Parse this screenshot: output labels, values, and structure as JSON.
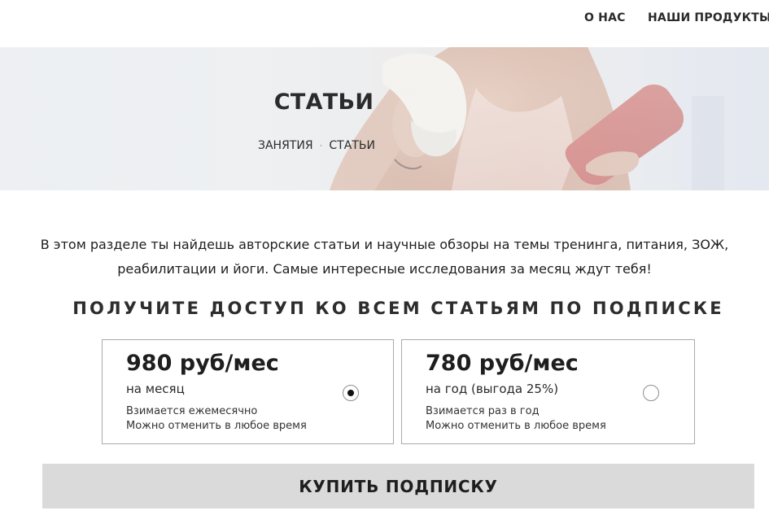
{
  "nav": {
    "items": [
      {
        "label": "О НАС"
      },
      {
        "label": "НАШИ ПРОДУКТЫ"
      }
    ]
  },
  "hero": {
    "title": "СТАТЬИ",
    "breadcrumb": {
      "items": [
        {
          "label": "ЗАНЯТИЯ"
        },
        {
          "label": "СТАТЬИ"
        }
      ],
      "separator": "·"
    }
  },
  "intro": {
    "text": "В этом разделе ты найдешь авторские статьи и научные обзоры на темы тренинга, питания, ЗОЖ, реабилитации и йоги. Самые интересные исследования за месяц ждут тебя!"
  },
  "subscription": {
    "heading": "ПОЛУЧИТЕ ДОСТУП КО ВСЕМ СТАТЬЯМ ПО ПОДПИСКЕ",
    "plans": [
      {
        "price": "980 руб/мес",
        "period": "на месяц",
        "note1": "Взимается ежемесячно",
        "note2": "Можно отменить в любое время",
        "selected": true
      },
      {
        "price": "780 руб/мес",
        "period": "на год (выгода 25%)",
        "note1": "Взимается раз в год",
        "note2": "Можно отменить в любое время",
        "selected": false
      }
    ],
    "buy_label": "КУПИТЬ ПОДПИСКУ"
  },
  "colors": {
    "button_bg": "#dadada",
    "border": "#a9a9a9",
    "text": "#1e1e1e"
  }
}
